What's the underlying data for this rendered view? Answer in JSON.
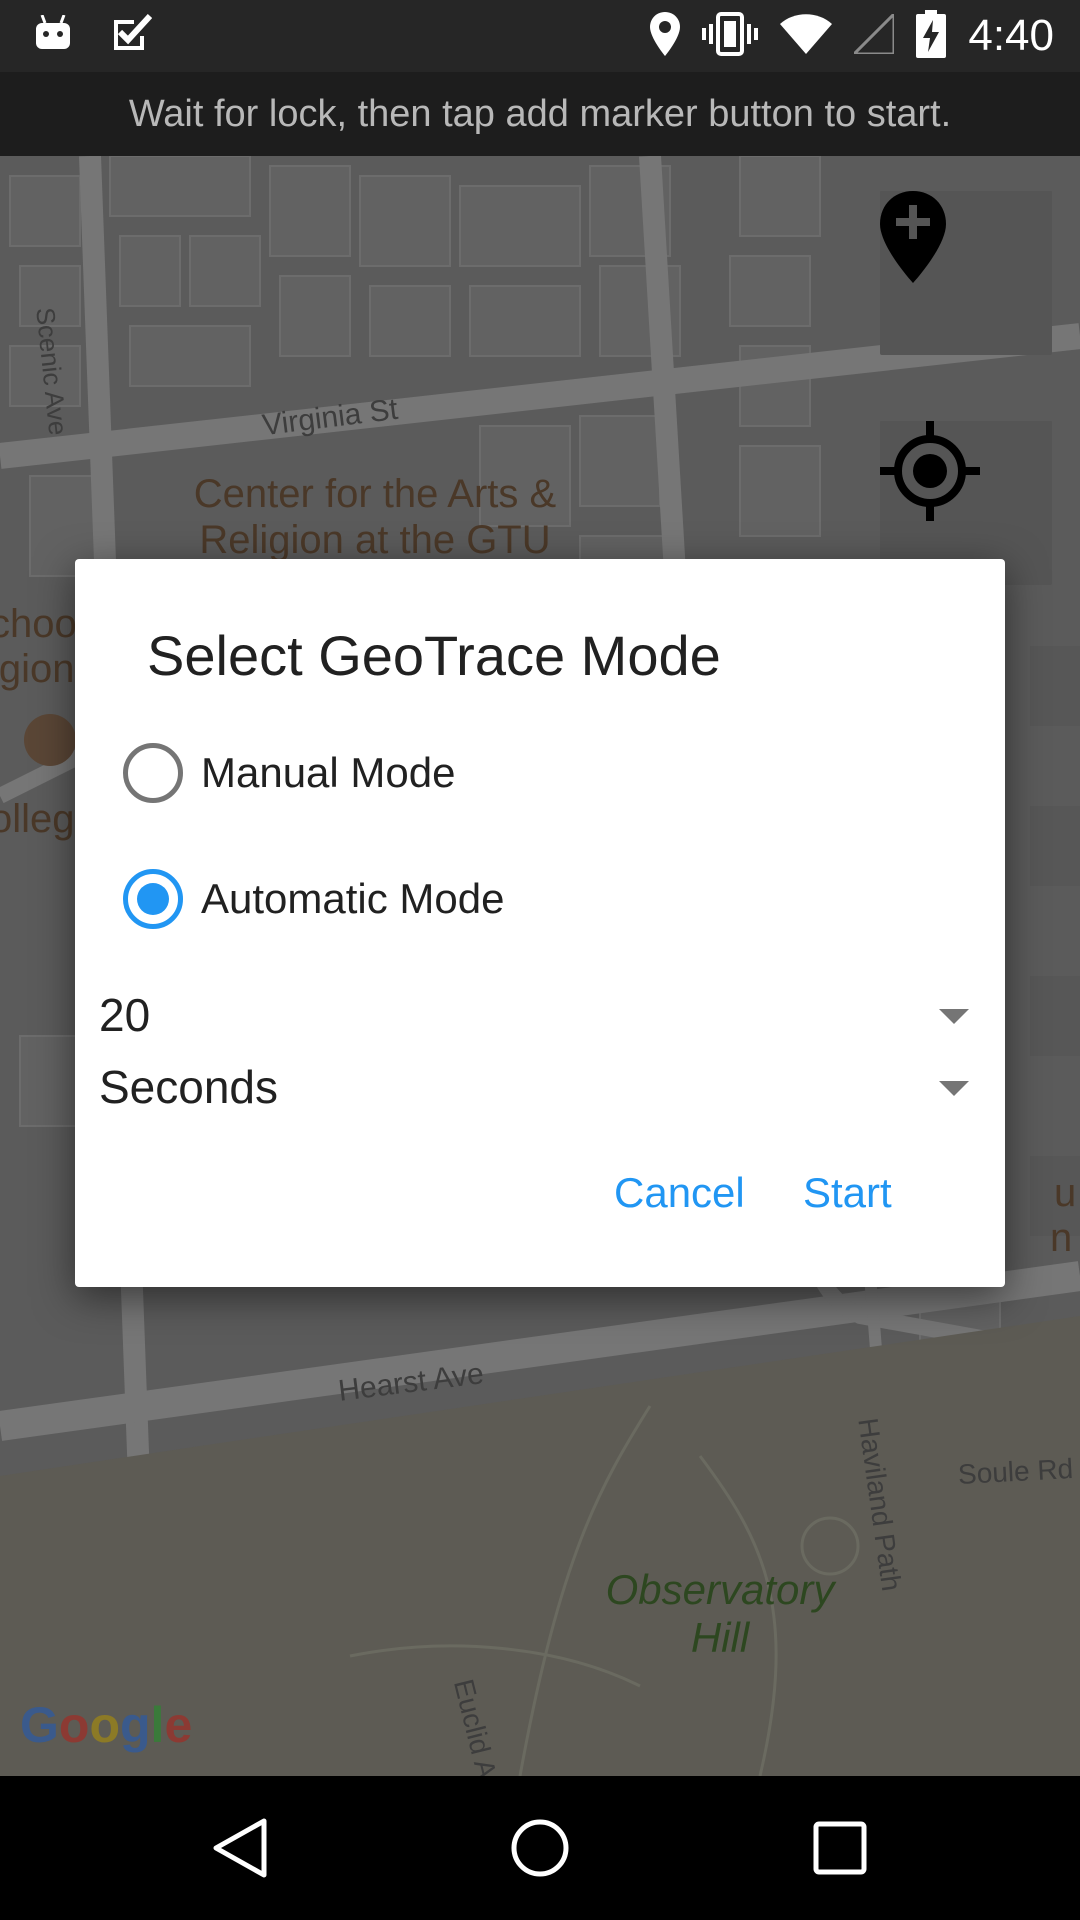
{
  "status_bar": {
    "time": "4:40",
    "icons_left": [
      "android-icon",
      "checkbox-icon"
    ],
    "icons_right": [
      "location-icon",
      "vibrate-icon",
      "wifi-icon",
      "signal-icon",
      "battery-charging-icon"
    ]
  },
  "info_bar": {
    "message": "Wait for lock, then tap add marker button to start."
  },
  "map": {
    "labels": {
      "scenic_ave": "Scenic Ave",
      "virginia_st": "Virginia St",
      "poi_line1": "Center for the Arts &",
      "poi_line2": "Religion at the GTU",
      "school_fragment": "choo",
      "religion_fragment": "igion",
      "college_fragment": "olleg",
      "hearst_ave": "Hearst Ave",
      "haviland_path": "Haviland Path",
      "soule_rd": "Soule Rd",
      "observatory_line1": "Observatory",
      "observatory_line2": "Hill",
      "euclid_fragment": "Euclid A",
      "right_fragment1": "u",
      "right_fragment2": "n"
    },
    "google_logo": "Google",
    "buttons": {
      "add_marker": "add-marker-icon",
      "my_location": "my-location-icon"
    }
  },
  "dialog": {
    "title": "Select GeoTrace Mode",
    "options": [
      {
        "label": "Manual Mode",
        "checked": false
      },
      {
        "label": "Automatic Mode",
        "checked": true
      }
    ],
    "interval_value": "20",
    "interval_unit": "Seconds",
    "cancel_label": "Cancel",
    "start_label": "Start"
  },
  "colors": {
    "accent": "#2196f3",
    "dialog_bg": "#ffffff",
    "status_bar": "#262626",
    "nav_bar": "#000000"
  }
}
